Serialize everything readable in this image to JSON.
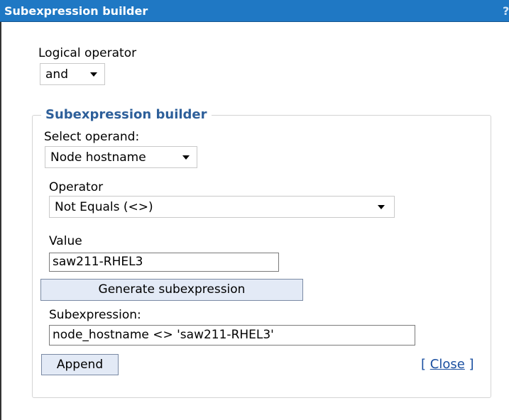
{
  "window": {
    "title": "Subexpression builder",
    "help_glyph": "?"
  },
  "logical_operator": {
    "label": "Logical operator",
    "selected": "and"
  },
  "builder": {
    "legend": "Subexpression builder",
    "operand": {
      "label": "Select operand:",
      "selected": "Node hostname"
    },
    "operator": {
      "label": "Operator",
      "selected": "Not Equals (<>)"
    },
    "value": {
      "label": "Value",
      "value": "saw211-RHEL3"
    },
    "generate_label": "Generate subexpression",
    "subexpression": {
      "label": "Subexpression:",
      "value": "node_hostname <> 'saw211-RHEL3'"
    },
    "append_label": "Append",
    "close": {
      "open_bracket": "[",
      "label": "Close",
      "close_bracket": "]"
    }
  },
  "colors": {
    "titlebar": "#1f78c4",
    "legend": "#2d5f9a",
    "button_bg": "#e3eaf6",
    "link": "#1a4fa0"
  }
}
